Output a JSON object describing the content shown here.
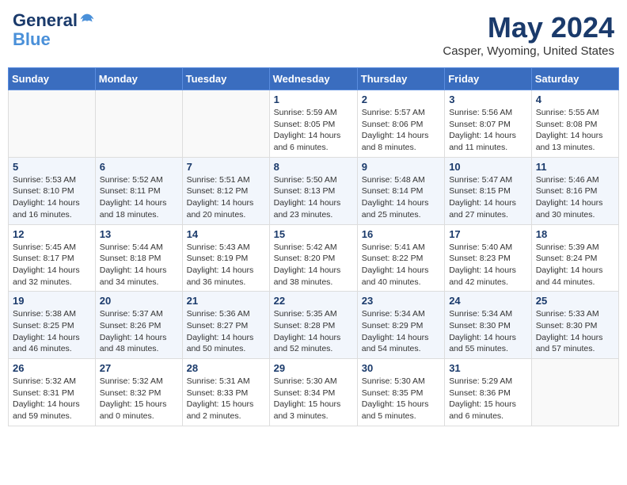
{
  "header": {
    "logo_line1": "General",
    "logo_line2": "Blue",
    "month": "May 2024",
    "location": "Casper, Wyoming, United States"
  },
  "days_of_week": [
    "Sunday",
    "Monday",
    "Tuesday",
    "Wednesday",
    "Thursday",
    "Friday",
    "Saturday"
  ],
  "weeks": [
    [
      {
        "day": "",
        "info": ""
      },
      {
        "day": "",
        "info": ""
      },
      {
        "day": "",
        "info": ""
      },
      {
        "day": "1",
        "info": "Sunrise: 5:59 AM\nSunset: 8:05 PM\nDaylight: 14 hours\nand 6 minutes."
      },
      {
        "day": "2",
        "info": "Sunrise: 5:57 AM\nSunset: 8:06 PM\nDaylight: 14 hours\nand 8 minutes."
      },
      {
        "day": "3",
        "info": "Sunrise: 5:56 AM\nSunset: 8:07 PM\nDaylight: 14 hours\nand 11 minutes."
      },
      {
        "day": "4",
        "info": "Sunrise: 5:55 AM\nSunset: 8:08 PM\nDaylight: 14 hours\nand 13 minutes."
      }
    ],
    [
      {
        "day": "5",
        "info": "Sunrise: 5:53 AM\nSunset: 8:10 PM\nDaylight: 14 hours\nand 16 minutes."
      },
      {
        "day": "6",
        "info": "Sunrise: 5:52 AM\nSunset: 8:11 PM\nDaylight: 14 hours\nand 18 minutes."
      },
      {
        "day": "7",
        "info": "Sunrise: 5:51 AM\nSunset: 8:12 PM\nDaylight: 14 hours\nand 20 minutes."
      },
      {
        "day": "8",
        "info": "Sunrise: 5:50 AM\nSunset: 8:13 PM\nDaylight: 14 hours\nand 23 minutes."
      },
      {
        "day": "9",
        "info": "Sunrise: 5:48 AM\nSunset: 8:14 PM\nDaylight: 14 hours\nand 25 minutes."
      },
      {
        "day": "10",
        "info": "Sunrise: 5:47 AM\nSunset: 8:15 PM\nDaylight: 14 hours\nand 27 minutes."
      },
      {
        "day": "11",
        "info": "Sunrise: 5:46 AM\nSunset: 8:16 PM\nDaylight: 14 hours\nand 30 minutes."
      }
    ],
    [
      {
        "day": "12",
        "info": "Sunrise: 5:45 AM\nSunset: 8:17 PM\nDaylight: 14 hours\nand 32 minutes."
      },
      {
        "day": "13",
        "info": "Sunrise: 5:44 AM\nSunset: 8:18 PM\nDaylight: 14 hours\nand 34 minutes."
      },
      {
        "day": "14",
        "info": "Sunrise: 5:43 AM\nSunset: 8:19 PM\nDaylight: 14 hours\nand 36 minutes."
      },
      {
        "day": "15",
        "info": "Sunrise: 5:42 AM\nSunset: 8:20 PM\nDaylight: 14 hours\nand 38 minutes."
      },
      {
        "day": "16",
        "info": "Sunrise: 5:41 AM\nSunset: 8:22 PM\nDaylight: 14 hours\nand 40 minutes."
      },
      {
        "day": "17",
        "info": "Sunrise: 5:40 AM\nSunset: 8:23 PM\nDaylight: 14 hours\nand 42 minutes."
      },
      {
        "day": "18",
        "info": "Sunrise: 5:39 AM\nSunset: 8:24 PM\nDaylight: 14 hours\nand 44 minutes."
      }
    ],
    [
      {
        "day": "19",
        "info": "Sunrise: 5:38 AM\nSunset: 8:25 PM\nDaylight: 14 hours\nand 46 minutes."
      },
      {
        "day": "20",
        "info": "Sunrise: 5:37 AM\nSunset: 8:26 PM\nDaylight: 14 hours\nand 48 minutes."
      },
      {
        "day": "21",
        "info": "Sunrise: 5:36 AM\nSunset: 8:27 PM\nDaylight: 14 hours\nand 50 minutes."
      },
      {
        "day": "22",
        "info": "Sunrise: 5:35 AM\nSunset: 8:28 PM\nDaylight: 14 hours\nand 52 minutes."
      },
      {
        "day": "23",
        "info": "Sunrise: 5:34 AM\nSunset: 8:29 PM\nDaylight: 14 hours\nand 54 minutes."
      },
      {
        "day": "24",
        "info": "Sunrise: 5:34 AM\nSunset: 8:30 PM\nDaylight: 14 hours\nand 55 minutes."
      },
      {
        "day": "25",
        "info": "Sunrise: 5:33 AM\nSunset: 8:30 PM\nDaylight: 14 hours\nand 57 minutes."
      }
    ],
    [
      {
        "day": "26",
        "info": "Sunrise: 5:32 AM\nSunset: 8:31 PM\nDaylight: 14 hours\nand 59 minutes."
      },
      {
        "day": "27",
        "info": "Sunrise: 5:32 AM\nSunset: 8:32 PM\nDaylight: 15 hours\nand 0 minutes."
      },
      {
        "day": "28",
        "info": "Sunrise: 5:31 AM\nSunset: 8:33 PM\nDaylight: 15 hours\nand 2 minutes."
      },
      {
        "day": "29",
        "info": "Sunrise: 5:30 AM\nSunset: 8:34 PM\nDaylight: 15 hours\nand 3 minutes."
      },
      {
        "day": "30",
        "info": "Sunrise: 5:30 AM\nSunset: 8:35 PM\nDaylight: 15 hours\nand 5 minutes."
      },
      {
        "day": "31",
        "info": "Sunrise: 5:29 AM\nSunset: 8:36 PM\nDaylight: 15 hours\nand 6 minutes."
      },
      {
        "day": "",
        "info": ""
      }
    ]
  ]
}
